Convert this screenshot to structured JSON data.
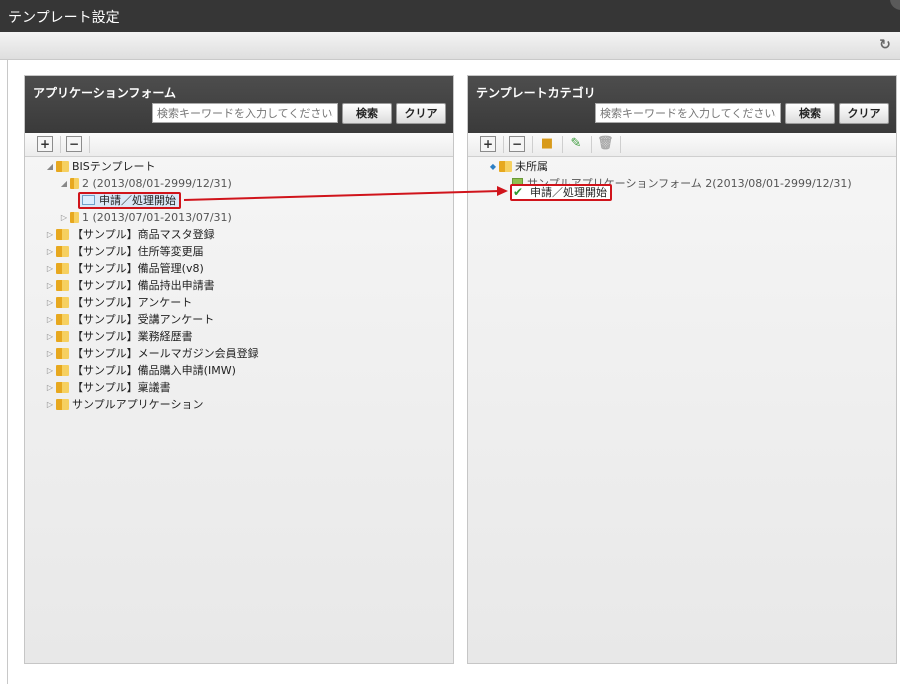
{
  "window": {
    "title": "テンプレート設定"
  },
  "toolbar": {
    "refresh_icon": "refresh-icon"
  },
  "left_panel": {
    "title": "アプリケーションフォーム",
    "search_placeholder": "検索キーワードを入力してください。",
    "search_label": "検索",
    "clear_label": "クリア",
    "tree": [
      {
        "label": "BISテンプレート"
      },
      {
        "label": "2 (2013/08/01-2999/12/31)"
      },
      {
        "label": "申請／処理開始"
      },
      {
        "label": "1 (2013/07/01-2013/07/31)"
      },
      {
        "label": "【サンプル】商品マスタ登録"
      },
      {
        "label": "【サンプル】住所等変更届"
      },
      {
        "label": "【サンプル】備品管理(v8)"
      },
      {
        "label": "【サンプル】備品持出申請書"
      },
      {
        "label": "【サンプル】アンケート"
      },
      {
        "label": "【サンプル】受講アンケート"
      },
      {
        "label": "【サンプル】業務経歴書"
      },
      {
        "label": "【サンプル】メールマガジン会員登録"
      },
      {
        "label": "【サンプル】備品購入申請(IMW)"
      },
      {
        "label": "【サンプル】稟議書"
      },
      {
        "label": "サンプルアプリケーション"
      }
    ]
  },
  "right_panel": {
    "title": "テンプレートカテゴリ",
    "search_placeholder": "検索キーワードを入力してください。",
    "search_label": "検索",
    "clear_label": "クリア",
    "tree": [
      {
        "label": "未所属"
      },
      {
        "label": "サンプルアプリケーションフォーム 2(2013/08/01-2999/12/31)"
      },
      {
        "label": "申請／処理開始"
      }
    ]
  },
  "colors": {
    "highlight": "#d0141b",
    "header": "#3a3a3a"
  }
}
